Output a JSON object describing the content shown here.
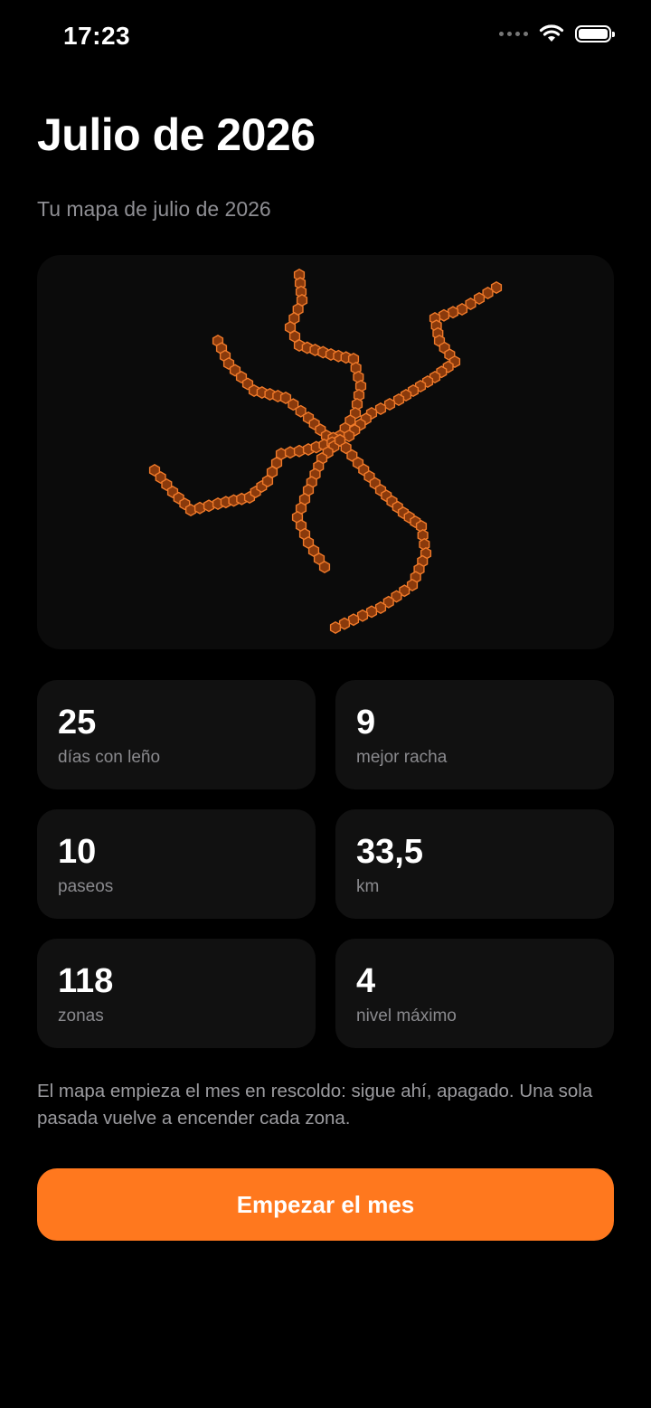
{
  "status_bar": {
    "time": "17:23",
    "icons": [
      "cellular-dots-icon",
      "wifi-icon",
      "battery-icon"
    ]
  },
  "header": {
    "title": "Julio de 2026",
    "subtitle": "Tu mapa de julio de 2026"
  },
  "map": {
    "fill_color": "#8a3a0c",
    "edge_color": "#f07a2a",
    "background": "#0b0b0b"
  },
  "stats": [
    {
      "value": "25",
      "label": "días con leño"
    },
    {
      "value": "9",
      "label": "mejor racha"
    },
    {
      "value": "10",
      "label": "paseos"
    },
    {
      "value": "33,5",
      "label": "km"
    },
    {
      "value": "118",
      "label": "zonas"
    },
    {
      "value": "4",
      "label": "nivel máximo"
    }
  ],
  "note": "El mapa empieza el mes en rescoldo: sigue ahí, apagado. Una sola pasada vuelve a encender cada zona.",
  "cta": {
    "label": "Empezar el mes"
  },
  "colors": {
    "accent": "#ff781e",
    "card": "#111111",
    "secondary_text": "#8e8e93"
  }
}
